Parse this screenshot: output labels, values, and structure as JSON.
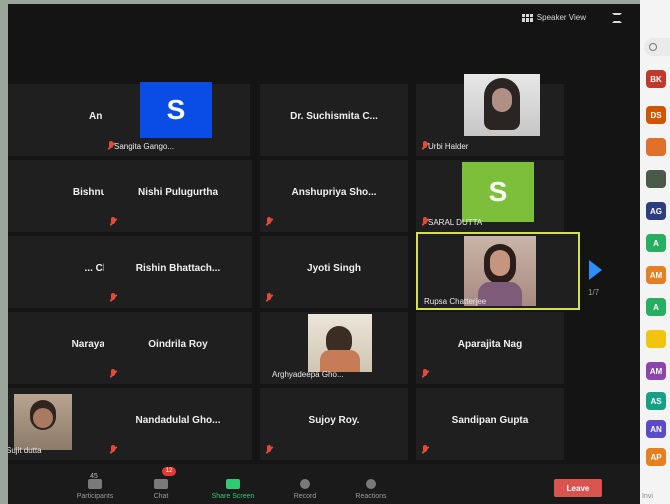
{
  "topbar": {
    "view_label": "Speaker View"
  },
  "tiles": [
    {
      "name": "Ananda K..."
    },
    {
      "label": "Sangita Gango...",
      "avatar_letter": "S",
      "avatar_color": "#0a4de6"
    },
    {
      "name": "Dr. Suchismita C..."
    },
    {
      "label": "Urbi Halder"
    },
    {
      "name": "Bishnu Biswas"
    },
    {
      "name": "Nishi Pulugurtha"
    },
    {
      "name": "Anshupriya Sho..."
    },
    {
      "label": "SARAL DUTTA",
      "avatar_letter": "S",
      "avatar_color": "#7cbf3a"
    },
    {
      "name": "... Chakrab..."
    },
    {
      "name": "Rishin Bhattach..."
    },
    {
      "name": "Jyoti Singh"
    },
    {
      "label": "Rupsa Chatterjee"
    },
    {
      "name": "Narayan Adhya"
    },
    {
      "name": "Oindrila Roy"
    },
    {
      "label": "Arghyadeepa Gho..."
    },
    {
      "name": "Aparajita Nag"
    },
    {
      "label": "Sujit dutta"
    },
    {
      "name": "Nandadulal Gho..."
    },
    {
      "name": "Sujoy Roy."
    },
    {
      "name": "Sandipan Gupta"
    }
  ],
  "pagination": {
    "page": "1/7"
  },
  "toolbar": {
    "participants_label": "Participants",
    "participants_count": "45",
    "chat_label": "Chat",
    "chat_badge": "12",
    "share_label": "Share Screen",
    "record_label": "Record",
    "reactions_label": "Reactions",
    "leave_label": "Leave"
  },
  "participants_panel": {
    "avatars": [
      {
        "initials": "BK",
        "color": "#c0392b"
      },
      {
        "initials": "DS",
        "color": "#d35400"
      },
      {
        "initials": "",
        "color": "#e0702a"
      },
      {
        "initials": "",
        "color": "#4a5a4a"
      },
      {
        "initials": "AG",
        "color": "#2c3e80"
      },
      {
        "initials": "A",
        "color": "#27ae60"
      },
      {
        "initials": "AM",
        "color": "#e67e22"
      },
      {
        "initials": "A",
        "color": "#27ae60"
      },
      {
        "initials": "",
        "color": "#f1c40f"
      },
      {
        "initials": "AM",
        "color": "#8e44ad"
      },
      {
        "initials": "AS",
        "color": "#16a085"
      },
      {
        "initials": "AN",
        "color": "#5b4bc4"
      },
      {
        "initials": "AP",
        "color": "#e67e22"
      }
    ],
    "footer_label": "Invi"
  }
}
